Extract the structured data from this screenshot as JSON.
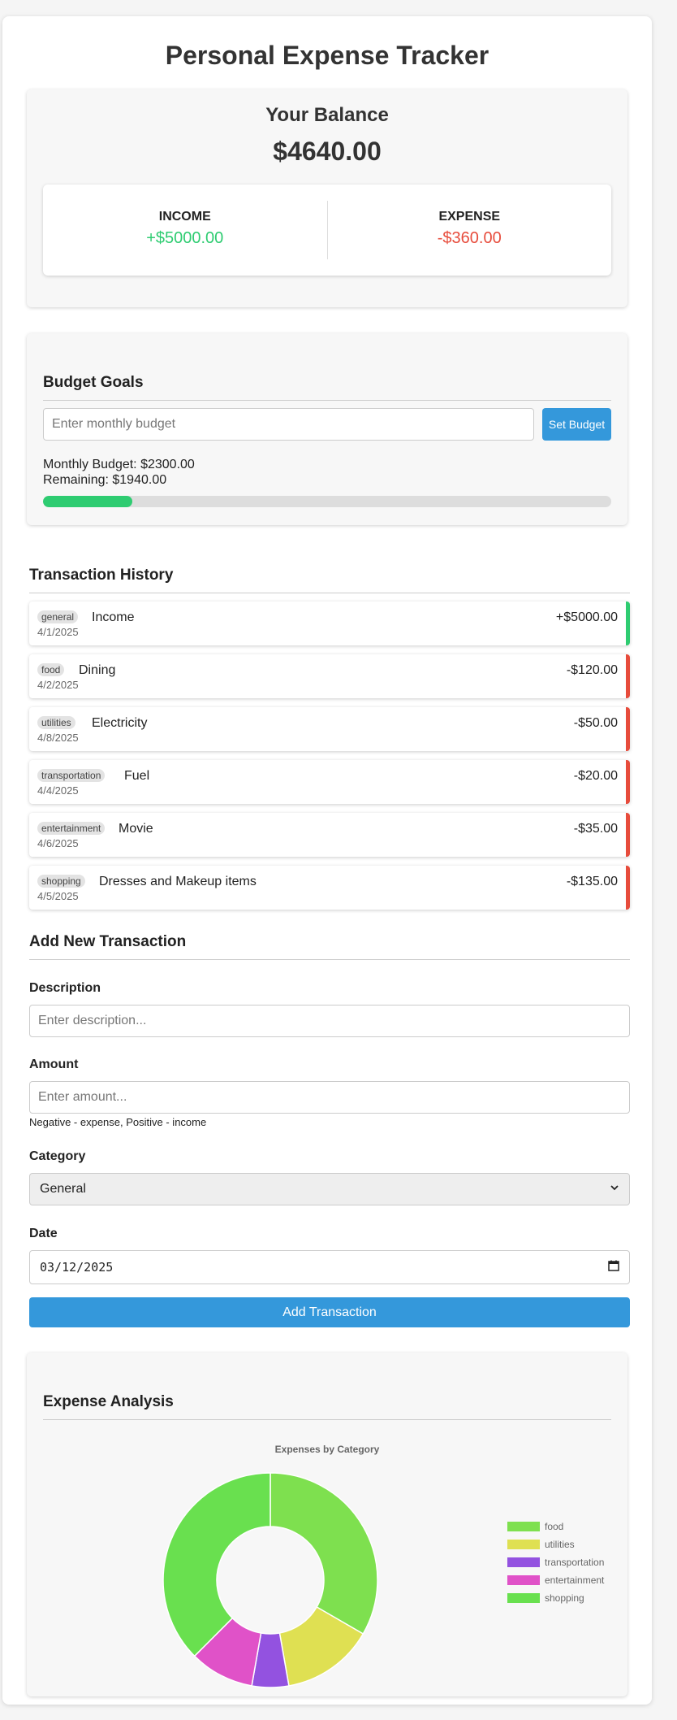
{
  "title": "Personal Expense Tracker",
  "balance": {
    "label": "Your Balance",
    "amount": "$4640.00",
    "income_label": "INCOME",
    "income_value": "+$5000.00",
    "expense_label": "EXPENSE",
    "expense_value": "-$360.00"
  },
  "budget": {
    "heading": "Budget Goals",
    "input_placeholder": "Enter monthly budget",
    "button_label": "Set Budget",
    "monthly_text": "Monthly Budget: $2300.00",
    "remaining_text": "Remaining: $1940.00",
    "progress_fraction": 0.157
  },
  "transactions": {
    "heading": "Transaction History",
    "items": [
      {
        "category": "general",
        "date": "4/1/2025",
        "description": "Income",
        "amount": "+$5000.00",
        "type": "income"
      },
      {
        "category": "food",
        "date": "4/2/2025",
        "description": "Dining",
        "amount": "-$120.00",
        "type": "expense"
      },
      {
        "category": "utilities",
        "date": "4/8/2025",
        "description": "Electricity",
        "amount": "-$50.00",
        "type": "expense"
      },
      {
        "category": "transportation",
        "date": "4/4/2025",
        "description": "Fuel",
        "amount": "-$20.00",
        "type": "expense"
      },
      {
        "category": "entertainment",
        "date": "4/6/2025",
        "description": "Movie",
        "amount": "-$35.00",
        "type": "expense"
      },
      {
        "category": "shopping",
        "date": "4/5/2025",
        "description": "Dresses and Makeup items",
        "amount": "-$135.00",
        "type": "expense"
      }
    ]
  },
  "form": {
    "heading": "Add New Transaction",
    "description_label": "Description",
    "description_placeholder": "Enter description...",
    "amount_label": "Amount",
    "amount_placeholder": "Enter amount...",
    "amount_hint": "Negative - expense, Positive - income",
    "category_label": "Category",
    "category_value": "General",
    "date_label": "Date",
    "date_value": "03/12/2025",
    "submit_label": "Add Transaction"
  },
  "analysis": {
    "heading": "Expense Analysis"
  },
  "chart_data": {
    "type": "pie",
    "title": "Expenses by Category",
    "categories": [
      "food",
      "utilities",
      "transportation",
      "entertainment",
      "shopping"
    ],
    "values": [
      120,
      50,
      20,
      35,
      135
    ],
    "colors": [
      "#7ee04f",
      "#dfe052",
      "#9352e0",
      "#e052c8",
      "#69e04f"
    ],
    "legend_position": "right"
  }
}
